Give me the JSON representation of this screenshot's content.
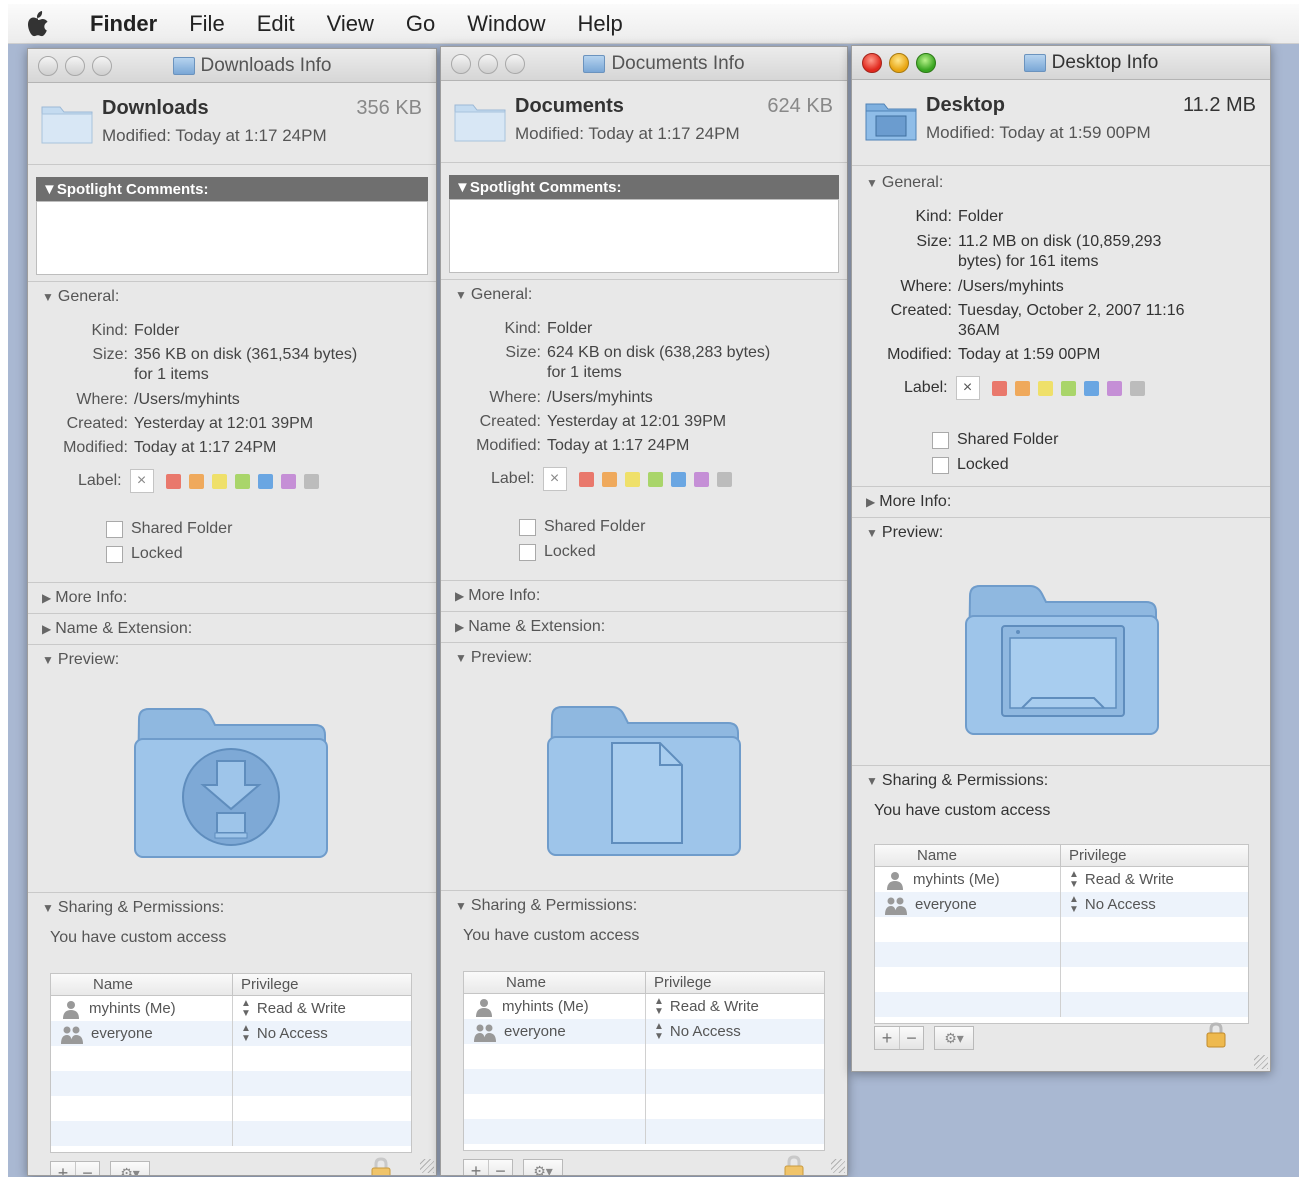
{
  "menubar": {
    "items": [
      "Finder",
      "File",
      "Edit",
      "View",
      "Go",
      "Window",
      "Help"
    ]
  },
  "windows": [
    {
      "title": "Downloads Info",
      "name": "Downloads",
      "size": "356 KB",
      "modified": "Modified: Today at 1:17 24PM",
      "spotlight_label": "Spotlight Comments:",
      "general_label": "General:",
      "kind_key": "Kind:",
      "kind": "Folder",
      "size_key": "Size:",
      "size_line1": "356 KB on disk (361,534 bytes)",
      "size_line2": "for 1 items",
      "where_key": "Where:",
      "where": "/Users/myhints",
      "created_key": "Created:",
      "created": "Yesterday at 12:01 39PM",
      "modified_key": "Modified:",
      "modified_val": "Today at 1:17 24PM",
      "label_key": "Label:",
      "shared_folder": "Shared Folder",
      "locked": "Locked",
      "more_info": "More Info:",
      "name_ext": "Name & Extension:",
      "preview_label": "Preview:",
      "sharing_label": "Sharing & Permissions:",
      "access_text": "You have custom access",
      "col_name": "Name",
      "col_priv": "Privilege",
      "rows": [
        {
          "name": "myhints (Me)",
          "priv": "Read & Write"
        },
        {
          "name": "everyone",
          "priv": "No Access"
        }
      ]
    },
    {
      "title": "Documents Info",
      "name": "Documents",
      "size": "624 KB",
      "modified": "Modified: Today at 1:17 24PM",
      "spotlight_label": "Spotlight Comments:",
      "general_label": "General:",
      "kind_key": "Kind:",
      "kind": "Folder",
      "size_key": "Size:",
      "size_line1": "624 KB on disk (638,283 bytes)",
      "size_line2": "for 1 items",
      "where_key": "Where:",
      "where": "/Users/myhints",
      "created_key": "Created:",
      "created": "Yesterday at 12:01 39PM",
      "modified_key": "Modified:",
      "modified_val": "Today at 1:17 24PM",
      "label_key": "Label:",
      "shared_folder": "Shared Folder",
      "locked": "Locked",
      "more_info": "More Info:",
      "name_ext": "Name & Extension:",
      "preview_label": "Preview:",
      "sharing_label": "Sharing & Permissions:",
      "access_text": "You have custom access",
      "col_name": "Name",
      "col_priv": "Privilege",
      "rows": [
        {
          "name": "myhints (Me)",
          "priv": "Read & Write"
        },
        {
          "name": "everyone",
          "priv": "No Access"
        }
      ]
    },
    {
      "title": "Desktop Info",
      "name": "Desktop",
      "size": "11.2 MB",
      "modified": "Modified: Today at 1:59 00PM",
      "general_label": "General:",
      "kind_key": "Kind:",
      "kind": "Folder",
      "size_key": "Size:",
      "size_line1": "11.2 MB on disk (10,859,293",
      "size_line2": "bytes) for 161 items",
      "where_key": "Where:",
      "where": "/Users/myhints",
      "created_key": "Created:",
      "created_line1": "Tuesday, October 2, 2007 11:16",
      "created_line2": "36AM",
      "modified_key": "Modified:",
      "modified_val": "Today at 1:59 00PM",
      "label_key": "Label:",
      "shared_folder": "Shared Folder",
      "locked": "Locked",
      "more_info": "More Info:",
      "preview_label": "Preview:",
      "sharing_label": "Sharing & Permissions:",
      "access_text": "You have custom access",
      "col_name": "Name",
      "col_priv": "Privilege",
      "rows": [
        {
          "name": "myhints (Me)",
          "priv": "Read & Write"
        },
        {
          "name": "everyone",
          "priv": "No Access"
        }
      ]
    }
  ],
  "icons": {
    "close": "close-icon",
    "minimize": "minimize-icon",
    "zoom": "zoom-icon",
    "disclosure_open": "triangle-down-icon",
    "disclosure_closed": "triangle-right-icon",
    "user": "user-icon",
    "group": "group-icon",
    "lock": "lock-icon",
    "gear": "gear-icon"
  },
  "label_colors": [
    "#e9786c",
    "#efa95c",
    "#efe06a",
    "#a9d56a",
    "#6aa6e2",
    "#c58fd6",
    "#bcbcbc"
  ],
  "colors": {
    "folder_light": "#9ec5ea",
    "folder_dark": "#6d9ccb",
    "desktop_bg": "#a9b8d2"
  }
}
